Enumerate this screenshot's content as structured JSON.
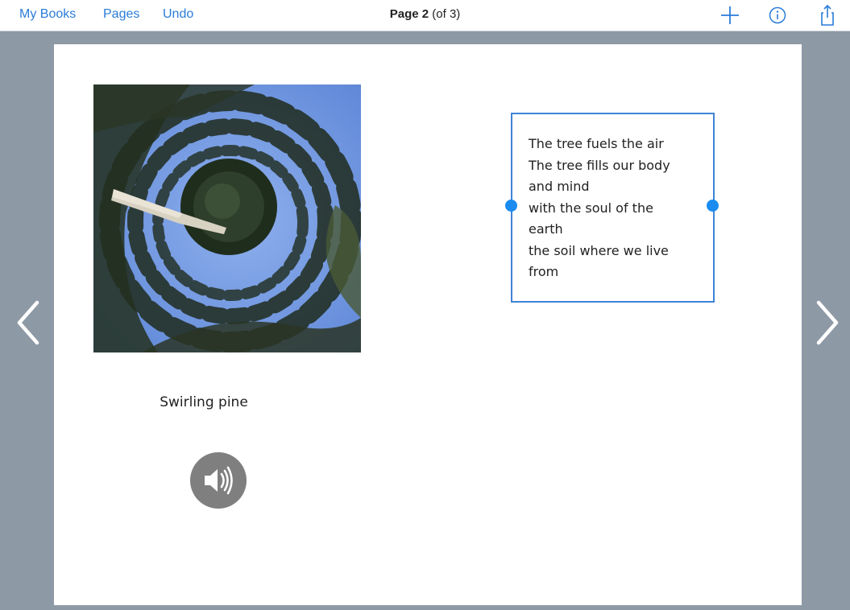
{
  "toolbar": {
    "my_books_label": "My Books",
    "pages_label": "Pages",
    "undo_label": "Undo",
    "page_title_bold": "Page 2",
    "page_title_rest": "(of 3)",
    "add_icon": "plus-icon",
    "info_icon": "info-icon",
    "share_icon": "share-icon"
  },
  "page": {
    "image_description_icon": "photo",
    "caption": "Swirling pine",
    "audio_icon": "speaker-icon",
    "textbox": {
      "lines": [
        "The tree fuels the air",
        "The tree fills our body",
        "and mind",
        "with the soul of the",
        "earth",
        "the soil where we live",
        "from"
      ]
    }
  },
  "navigation": {
    "prev_icon": "chevron-left-icon",
    "next_icon": "chevron-right-icon"
  },
  "colors": {
    "accent": "#2a7cd8",
    "background": "#8e99a6",
    "selection_border": "#3e84d6",
    "handle": "#1a8cf0"
  }
}
